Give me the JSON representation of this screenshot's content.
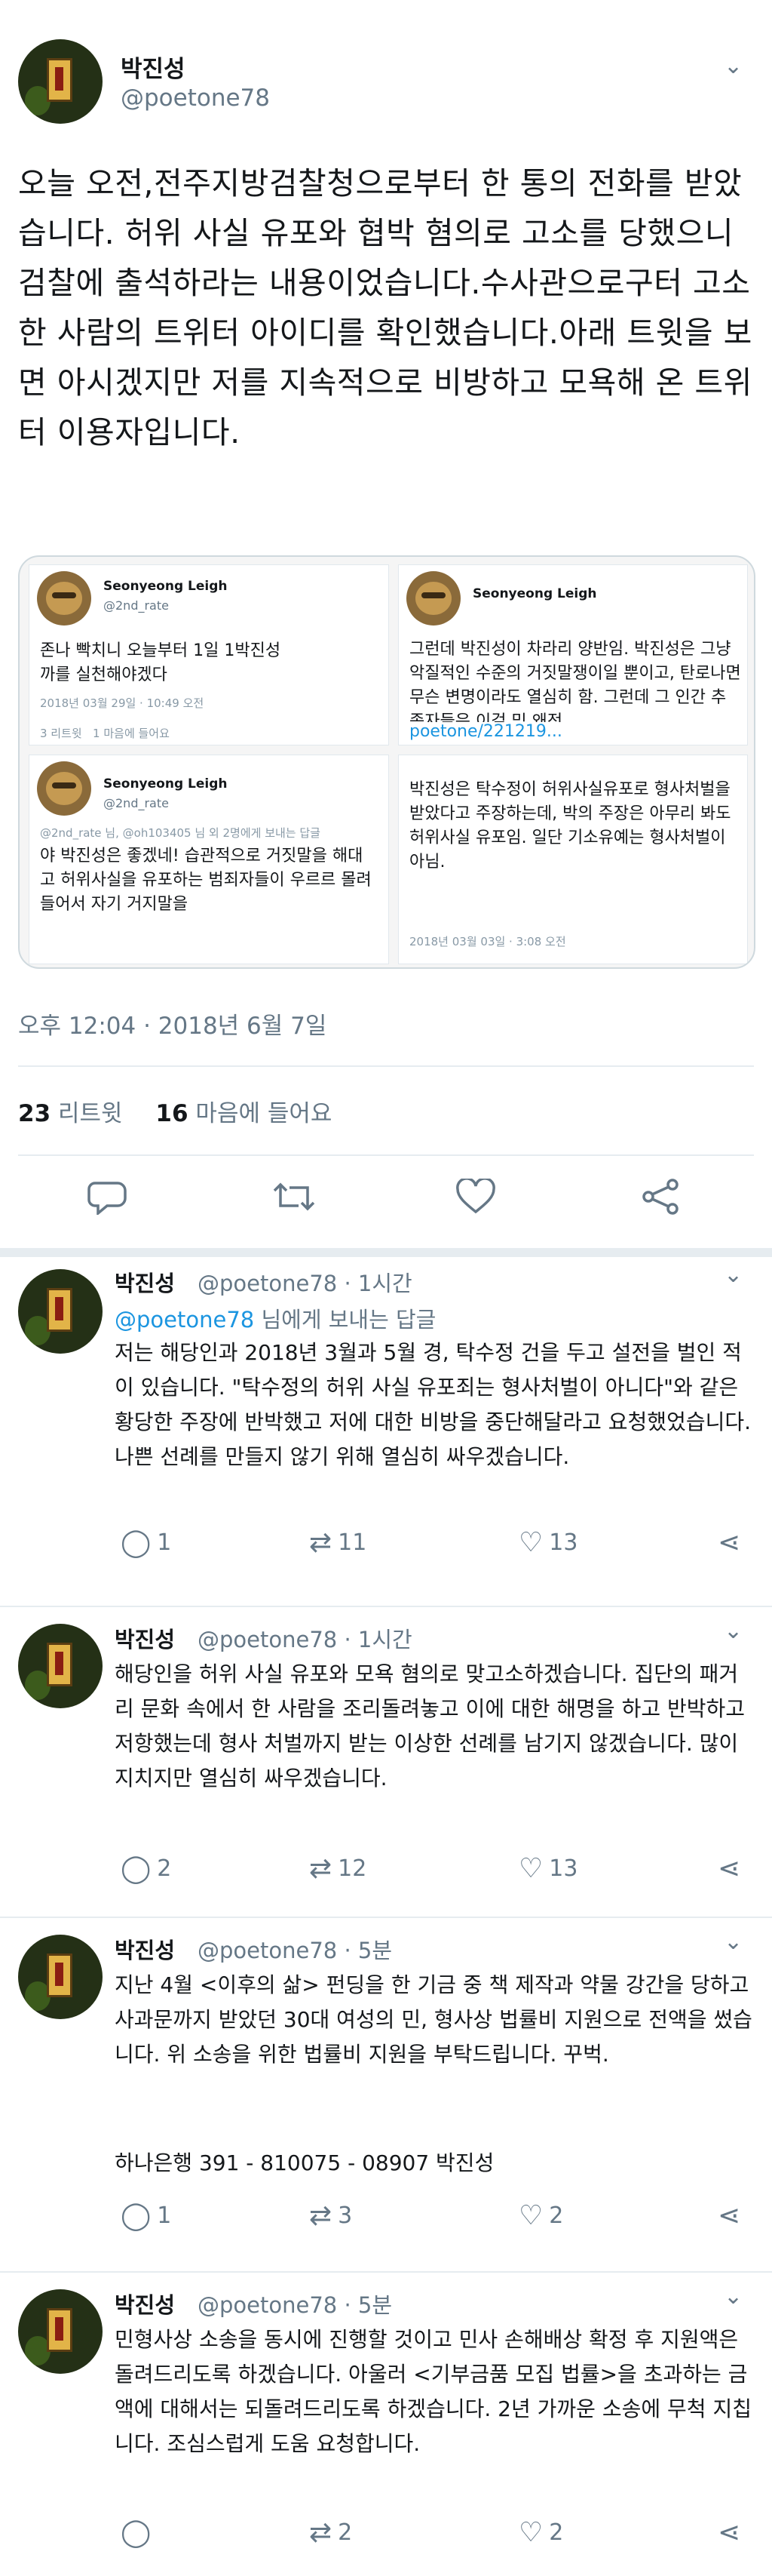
{
  "tweet": {
    "author_name": "박진성",
    "author_handle": "@poetone78",
    "text": "오늘 오전,전주지방검찰청으로부터 한 통의 전화를 받았습니다. 허위 사실 유포와 협박 혐의로 고소를 당했으니 검찰에 출석하라는 내용이었습니다.수사관으로구터 고소한 사람의 트위터 아이디를 확인했습니다.아래 트윗을 보면 아시겠지만 저를 지속적으로 비방하고 모욕해 온 트위터 이용자입니다.",
    "timestamp": "오후 12:04 · 2018년 6월 7일",
    "retweets_count": "23",
    "retweets_label": "리트윗",
    "likes_count": "16",
    "likes_label": "마음에 들어요"
  },
  "embedded": {
    "tl": {
      "name": "Seonyeong Leigh",
      "handle": "@2nd_rate",
      "text": "존나 빡치니 오늘부터 1일 1박진성까를 실천해야겠다",
      "meta": "2018년 03월 29일 · 10:49 오전",
      "rt": "3 리트윗",
      "like": "1 마음에 들어요"
    },
    "bl": {
      "name": "Seonyeong Leigh",
      "handle": "@2nd_rate",
      "reply": "@2nd_rate 님, @oh103405 님 외 2명에게 보내는 답글",
      "text": "야 박진성은 좋겠네! 습관적으로 거짓말을 해대고 허위사실을 유포하는 범죄자들이 우르르 몰려들어서 자기 거지말을"
    },
    "tr": {
      "name": "Seonyeong Leigh",
      "text": "그런데 박진성이 차라리 양반임. 박진성은 그냥 악질적인 수준의 거짓말쟁이일 뿐이고, 탄로나면 무슨 변명이라도 열심히 함. 그런데 그 인간 추종자들은 이걸 믿 왜전",
      "link": "poetone/221219..."
    },
    "br": {
      "text": "박진성은 탁수정이 허위사실유포로 형사처벌을 받았다고 주장하는데, 박의 주장은 아무리 봐도 허위사실 유포임. 일단 기소유예는 형사처벌이 아님.",
      "meta": "2018년 03월 03일 · 3:08 오전"
    }
  },
  "replies": [
    {
      "name": "박진성",
      "handle": "@poetone78",
      "time": "· 1시간",
      "reply_to_handle": "@poetone78",
      "reply_to_suffix": " 님에게 보내는 답글",
      "text": "저는 해당인과 2018년 3월과 5월 경, 탁수정 건을 두고 설전을 벌인 적이 있습니다. \"탁수정의 허위 사실 유포죄는 형사처벌이 아니다\"와 같은 황당한 주장에 반박했고 저에 대한 비방을 중단해달라고 요청했었습니다. 나쁜 선례를 만들지 않기 위해 열심히 싸우겠습니다.",
      "replies_count": "1",
      "retweets_count": "11",
      "likes_count": "13"
    },
    {
      "name": "박진성",
      "handle": "@poetone78",
      "time": "· 1시간",
      "text": "해당인을 허위 사실 유포와 모욕 혐의로 맞고소하겠습니다. 집단의 패거리 문화 속에서 한 사람을 조리돌려놓고 이에 대한 해명을 하고 반박하고 저항했는데 형사 처벌까지 받는 이상한 선례를 남기지 않겠습니다. 많이 지치지만 열심히 싸우겠습니다.",
      "replies_count": "2",
      "retweets_count": "12",
      "likes_count": "13"
    },
    {
      "name": "박진성",
      "handle": "@poetone78",
      "time": "· 5분",
      "text": "지난 4월 <이후의 삶> 펀딩을 한 기금 중 책 제작과 약물 강간을 당하고 사과문까지 받았던 30대 여성의 민, 형사상 법률비 지원으로 전액을 썼습니다. 위 소송을 위한 법률비 지원을 부탁드립니다. 꾸벅.",
      "text2": "하나은행 391 - 810075 - 08907 박진성",
      "replies_count": "1",
      "retweets_count": "3",
      "likes_count": "2"
    },
    {
      "name": "박진성",
      "handle": "@poetone78",
      "time": "· 5분",
      "text": "민형사상 소송을 동시에 진행할 것이고 민사 손해배상 확정 후 지원액은 돌려드리도록 하겠습니다. 아울러 <기부금품 모집 법률>을 초과하는 금액에 대해서는 되돌려드리도록 하겠습니다. 2년 가까운 소송에 무척 지칩니다. 조심스럽게 도움 요청합니다.",
      "replies_count": "",
      "retweets_count": "2",
      "likes_count": "2"
    }
  ]
}
